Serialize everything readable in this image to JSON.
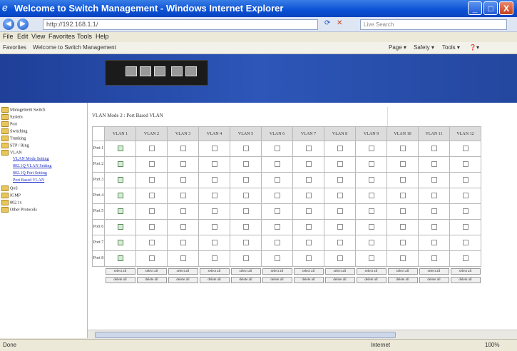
{
  "window": {
    "title": "Welcome to Switch Management - Windows Internet Explorer",
    "min": "_",
    "max": "□",
    "close": "X"
  },
  "toolbar": {
    "back": "◀",
    "forward": "▶",
    "url": "http://192.168.1.1/",
    "search_placeholder": "Live Search",
    "refresh": "⟳",
    "stop": "✕"
  },
  "menu": {
    "file": "File",
    "edit": "Edit",
    "view": "View",
    "favorites": "Favorites",
    "tools": "Tools",
    "help": "Help"
  },
  "favbar": {
    "favorites": "Favorites",
    "tab": "Welcome to Switch Management",
    "page": "Page ▾",
    "safety": "Safety ▾",
    "tools": "Tools ▾",
    "help": "❓▾"
  },
  "sidebar": {
    "items": [
      {
        "label": "Management Switch"
      },
      {
        "label": "System"
      },
      {
        "label": "Port"
      },
      {
        "label": "Switching"
      },
      {
        "label": "Trunking"
      },
      {
        "label": "STP / Ring"
      },
      {
        "label": "VLAN"
      },
      {
        "label": "VLAN Mode Setting",
        "sub": true
      },
      {
        "label": "802.1Q VLAN Setting",
        "sub": true
      },
      {
        "label": "802.1Q Port Setting",
        "sub": true
      },
      {
        "label": "Port Based VLAN",
        "sub": true
      },
      {
        "label": "QoS"
      },
      {
        "label": "IGMP"
      },
      {
        "label": "802.1x"
      },
      {
        "label": "Other Protocols"
      }
    ]
  },
  "main": {
    "title": "VLAN Mode 2 : Port Based VLAN",
    "vlan_headers": [
      "VLAN 1",
      "VLAN 2",
      "VLAN 3",
      "VLAN 4",
      "VLAN 5",
      "VLAN 6",
      "VLAN 7",
      "VLAN 8",
      "VLAN 9",
      "VLAN 10",
      "VLAN 11",
      "VLAN 12"
    ],
    "port_labels": [
      "Port 1",
      "Port 2",
      "Port 3",
      "Port 4",
      "Port 5",
      "Port 6",
      "Port 7",
      "Port 8"
    ],
    "select_all": "select all",
    "delete_all": "delete all"
  },
  "status": {
    "left": "Done",
    "zone": "Internet",
    "zoom": "100%"
  }
}
